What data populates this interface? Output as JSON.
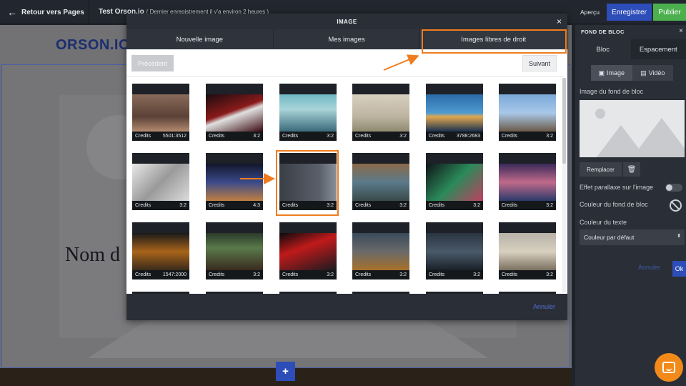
{
  "topbar": {
    "back_label": "Retour vers Pages",
    "page_title": "Test Orson.io",
    "page_subtitle": "( Dernier enregistrement il y'a environ 2 heures )",
    "preview_label": "Aperçu",
    "save_label": "Enregistrer",
    "publish_label": "Publier"
  },
  "editor": {
    "logo": "ORSON.IO",
    "heading": "Nom d",
    "add_block_label": "+"
  },
  "right_panel": {
    "title": "FOND DE BLOC",
    "close": "×",
    "tabs": [
      "Bloc",
      "Espacement"
    ],
    "media_toggle": [
      "Image",
      "Vidéo"
    ],
    "bg_image_label": "Image du fond de bloc",
    "replace_label": "Remplacer",
    "parallax_label": "Effet parallaxe sur l'image",
    "bg_color_label": "Couleur du fond de bloc",
    "text_color_label": "Couleur du texte",
    "text_color_value": "Couleur par défaut",
    "cancel_label": "Annuler",
    "ok_label": "Ok"
  },
  "modal": {
    "title": "IMAGE",
    "close": "×",
    "tabs": [
      {
        "label": "Nouvelle image",
        "active": false
      },
      {
        "label": "Mes images",
        "active": false
      },
      {
        "label": "Images libres de droit",
        "active": true
      }
    ],
    "prev_label": "Précédent",
    "next_label": "Suivant",
    "cancel_label": "Annuler",
    "images": [
      {
        "credits": "Credits",
        "ratio": "5501:3512"
      },
      {
        "credits": "Credits",
        "ratio": "3:2"
      },
      {
        "credits": "Credits",
        "ratio": "3:2"
      },
      {
        "credits": "Credits",
        "ratio": "3:2"
      },
      {
        "credits": "Credits",
        "ratio": "3788:2683"
      },
      {
        "credits": "Credits",
        "ratio": "3:2"
      },
      {
        "credits": "Credits",
        "ratio": "3:2"
      },
      {
        "credits": "Credits",
        "ratio": "4:3"
      },
      {
        "credits": "Credits",
        "ratio": "3:2"
      },
      {
        "credits": "Credits",
        "ratio": "3:2"
      },
      {
        "credits": "Credits",
        "ratio": "3:2"
      },
      {
        "credits": "Credits",
        "ratio": "3:2"
      },
      {
        "credits": "Credits",
        "ratio": "1547:2000"
      },
      {
        "credits": "Credits",
        "ratio": "3:2"
      },
      {
        "credits": "Credits",
        "ratio": "3:2"
      },
      {
        "credits": "Credits",
        "ratio": "3:2"
      },
      {
        "credits": "Credits",
        "ratio": "3:2"
      },
      {
        "credits": "Credits",
        "ratio": "3:2"
      }
    ]
  },
  "colors": {
    "accent_orange": "#f07c1f",
    "primary_blue": "#2d4db8",
    "publish_green": "#4cb04e"
  }
}
